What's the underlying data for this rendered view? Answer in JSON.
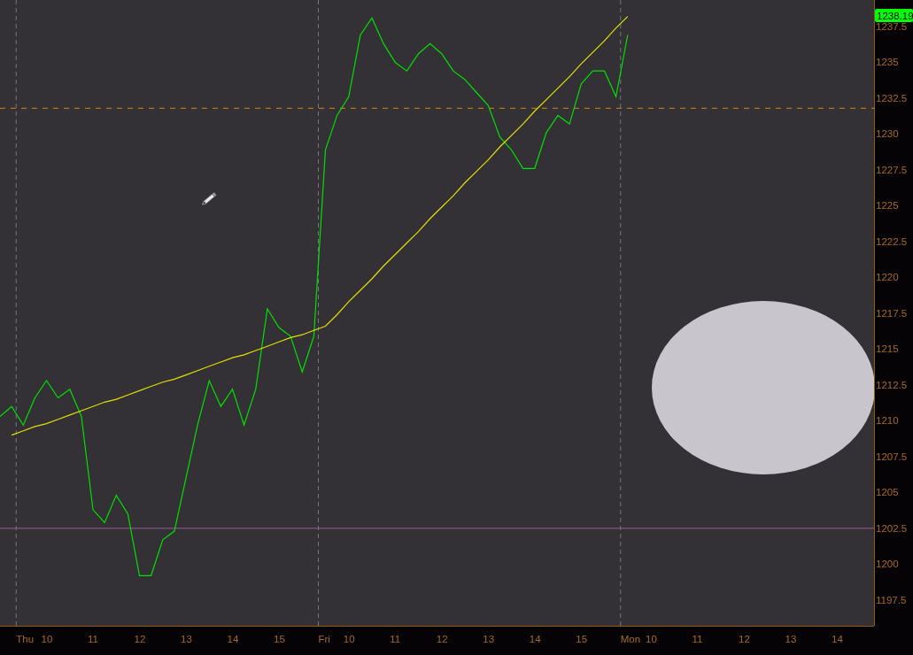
{
  "chart": {
    "chart_data": {
      "type": "line",
      "ylim": [
        1195.7,
        1239.35
      ],
      "categories": [
        null,
        null,
        "Thu",
        null,
        "10",
        null,
        null,
        null,
        "11",
        null,
        null,
        null,
        "12",
        null,
        null,
        null,
        "13",
        null,
        null,
        null,
        "14",
        null,
        null,
        null,
        "15",
        null,
        null,
        null,
        "Fri",
        null,
        "10",
        null,
        null,
        null,
        "11",
        null,
        null,
        null,
        "12",
        null,
        null,
        null,
        "13",
        null,
        null,
        null,
        "14",
        null,
        null,
        null,
        "15",
        null,
        null,
        null,
        "Mon",
        null,
        "10",
        null,
        null,
        null,
        "11",
        null,
        null,
        null,
        "12",
        null,
        null,
        null,
        "13",
        null,
        null,
        null,
        "14",
        null,
        null,
        null
      ],
      "series": [
        {
          "color": "#00e000",
          "values": [
            1210.3,
            1211.0,
            1209.7,
            1211.6,
            1212.8,
            1211.6,
            1212.2,
            1210.3,
            1203.8,
            1202.9,
            1204.8,
            1203.5,
            1199.2,
            1199.2,
            1201.7,
            1202.3,
            1206.0,
            1209.7,
            1212.8,
            1211.0,
            1212.2,
            1209.7,
            1212.2,
            1217.8,
            1216.5,
            1215.9,
            1213.4,
            1215.9,
            1228.9,
            1231.3,
            1232.6,
            1236.9,
            1238.1,
            1236.3,
            1235.0,
            1234.4,
            1235.6,
            1236.3,
            1235.6,
            1234.4,
            1233.8,
            1232.9,
            1232.0,
            1229.8,
            1228.9,
            1227.6,
            1227.6,
            1230.1,
            1231.3,
            1230.7,
            1233.5,
            1234.4,
            1234.4,
            1232.6,
            1236.9,
            null,
            null,
            null,
            null,
            null,
            null,
            null,
            null,
            null,
            null,
            null,
            null,
            null,
            null,
            null,
            null,
            null,
            null,
            null,
            null,
            null
          ]
        },
        {
          "color": "#e0e000",
          "values": [
            null,
            1209.0,
            1209.3,
            1209.6,
            1209.8,
            1210.1,
            1210.4,
            1210.7,
            1211.0,
            1211.3,
            1211.5,
            1211.8,
            1212.1,
            1212.4,
            1212.7,
            1212.9,
            1213.2,
            1213.5,
            1213.8,
            1214.1,
            1214.4,
            1214.6,
            1214.9,
            1215.2,
            1215.5,
            1215.8,
            1216.0,
            1216.3,
            1216.6,
            1217.4,
            1218.3,
            1219.1,
            1219.9,
            1220.8,
            1221.6,
            1222.4,
            1223.2,
            1224.1,
            1224.9,
            1225.7,
            1226.6,
            1227.4,
            1228.2,
            1229.1,
            1229.9,
            1230.7,
            1231.6,
            1232.4,
            1233.2,
            1234.0,
            1234.9,
            1235.7,
            1236.5,
            1237.4,
            1238.2,
            null,
            null,
            null,
            null,
            null,
            null,
            null,
            null,
            null,
            null,
            null,
            null,
            null,
            null,
            null,
            null,
            null,
            null,
            null,
            null,
            null
          ]
        }
      ],
      "ref_lines": [
        {
          "axis": "y",
          "value": 1231.8,
          "color": "#d08c00"
        },
        {
          "axis": "y",
          "value": 1202.5,
          "color": "#9a5a9a"
        }
      ],
      "yticks": [
        {
          "value": 1197.5,
          "label": "1197.5"
        },
        {
          "value": 1200,
          "label": "1200"
        },
        {
          "value": 1202.5,
          "label": "1202.5"
        },
        {
          "value": 1205,
          "label": "1205"
        },
        {
          "value": 1207.5,
          "label": "1207.5"
        },
        {
          "value": 1210,
          "label": "1210"
        },
        {
          "value": 1212.5,
          "label": "1212.5"
        },
        {
          "value": 1215,
          "label": "1215"
        },
        {
          "value": 1217.5,
          "label": "1217.5"
        },
        {
          "value": 1220,
          "label": "1220"
        },
        {
          "value": 1222.5,
          "label": "1222.5"
        },
        {
          "value": 1225,
          "label": "1225"
        },
        {
          "value": 1227.5,
          "label": "1227.5"
        },
        {
          "value": 1230,
          "label": "1230"
        },
        {
          "value": 1232.5,
          "label": "1232.5"
        },
        {
          "value": 1235,
          "label": "1235"
        },
        {
          "value": 1237.5,
          "label": "1237.5"
        }
      ]
    },
    "last_price_label": "1238.19"
  }
}
